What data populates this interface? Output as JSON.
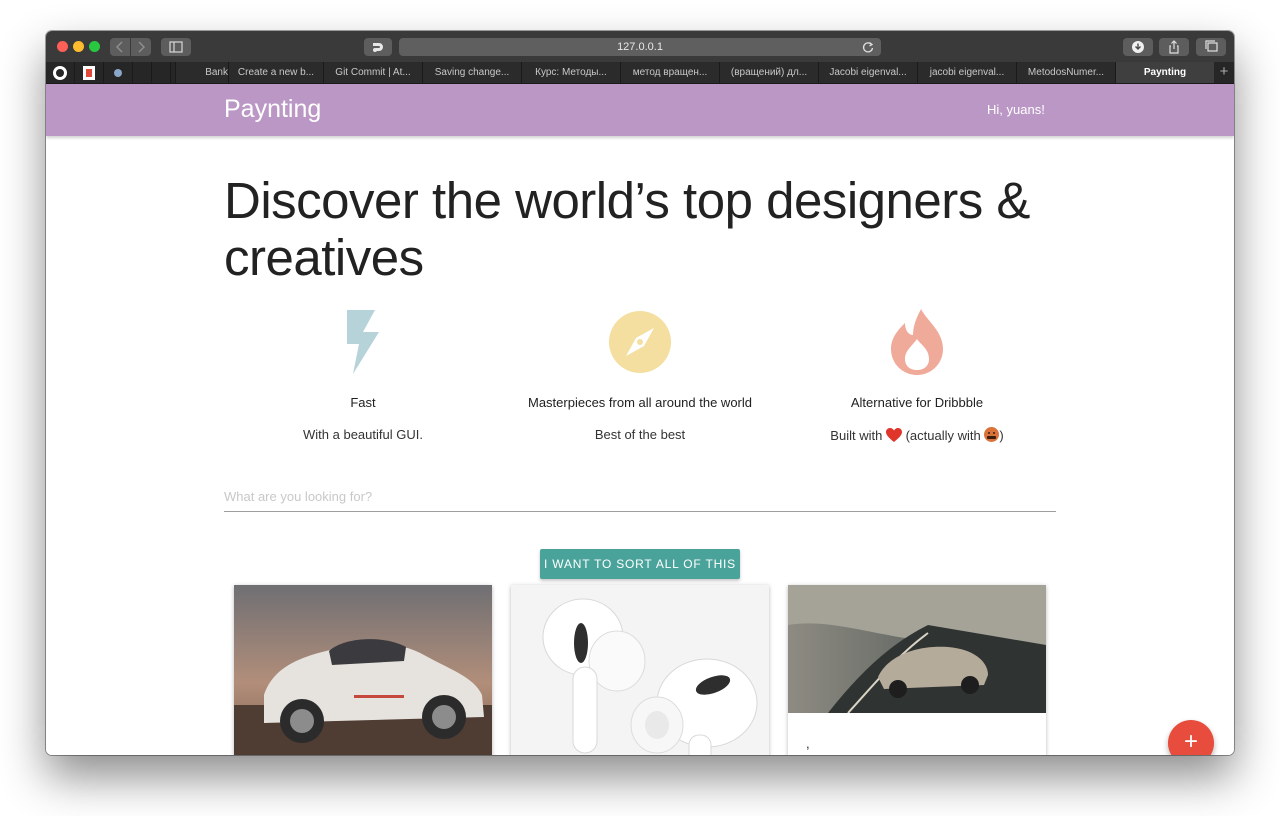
{
  "browser": {
    "address": "127.0.0.1",
    "tabs": [
      {
        "label": "Bank"
      },
      {
        "label": "Create a new b..."
      },
      {
        "label": "Git Commit | At..."
      },
      {
        "label": "Saving change..."
      },
      {
        "label": "Курс: Методы..."
      },
      {
        "label": "метод вращен..."
      },
      {
        "label": "(вращений) дл..."
      },
      {
        "label": "Jacobi eigenval..."
      },
      {
        "label": "jacobi eigenval..."
      },
      {
        "label": "MetodosNumer..."
      },
      {
        "label": "Paynting",
        "active": true
      }
    ],
    "new_tab": "+"
  },
  "header": {
    "brand": "Paynting",
    "greeting": "Hi, yuans!",
    "color": "#bb97c5"
  },
  "hero": {
    "title": "Discover the world’s top designers & creatives"
  },
  "features": [
    {
      "icon": "lightning-icon",
      "title": "Fast",
      "description": "With a beautiful GUI.",
      "color": "#b7d3da"
    },
    {
      "icon": "compass-icon",
      "title": "Masterpieces from all around the world",
      "description": "Best of the best",
      "color": "#f4dea0"
    },
    {
      "icon": "flame-icon",
      "title": "Alternative for Dribbble",
      "desc_prefix": "Built with",
      "desc_middle": "(actually with",
      "desc_suffix": ")",
      "color": "#f0aa9a"
    }
  ],
  "search": {
    "placeholder": "What are you looking for?",
    "value": ""
  },
  "sort_button": {
    "label": "I WANT TO SORT ALL OF THIS",
    "color": "#4aa39a"
  },
  "cards": [
    {
      "image": "white-porsche-911-car-photo",
      "caption": ""
    },
    {
      "image": "white-airpods-pro-earbuds-photo",
      "caption": ""
    },
    {
      "image": "silver-mclaren-sports-car-on-road-photo",
      "caption": ","
    }
  ],
  "fab": {
    "label": "+",
    "color": "#e74c3c"
  }
}
